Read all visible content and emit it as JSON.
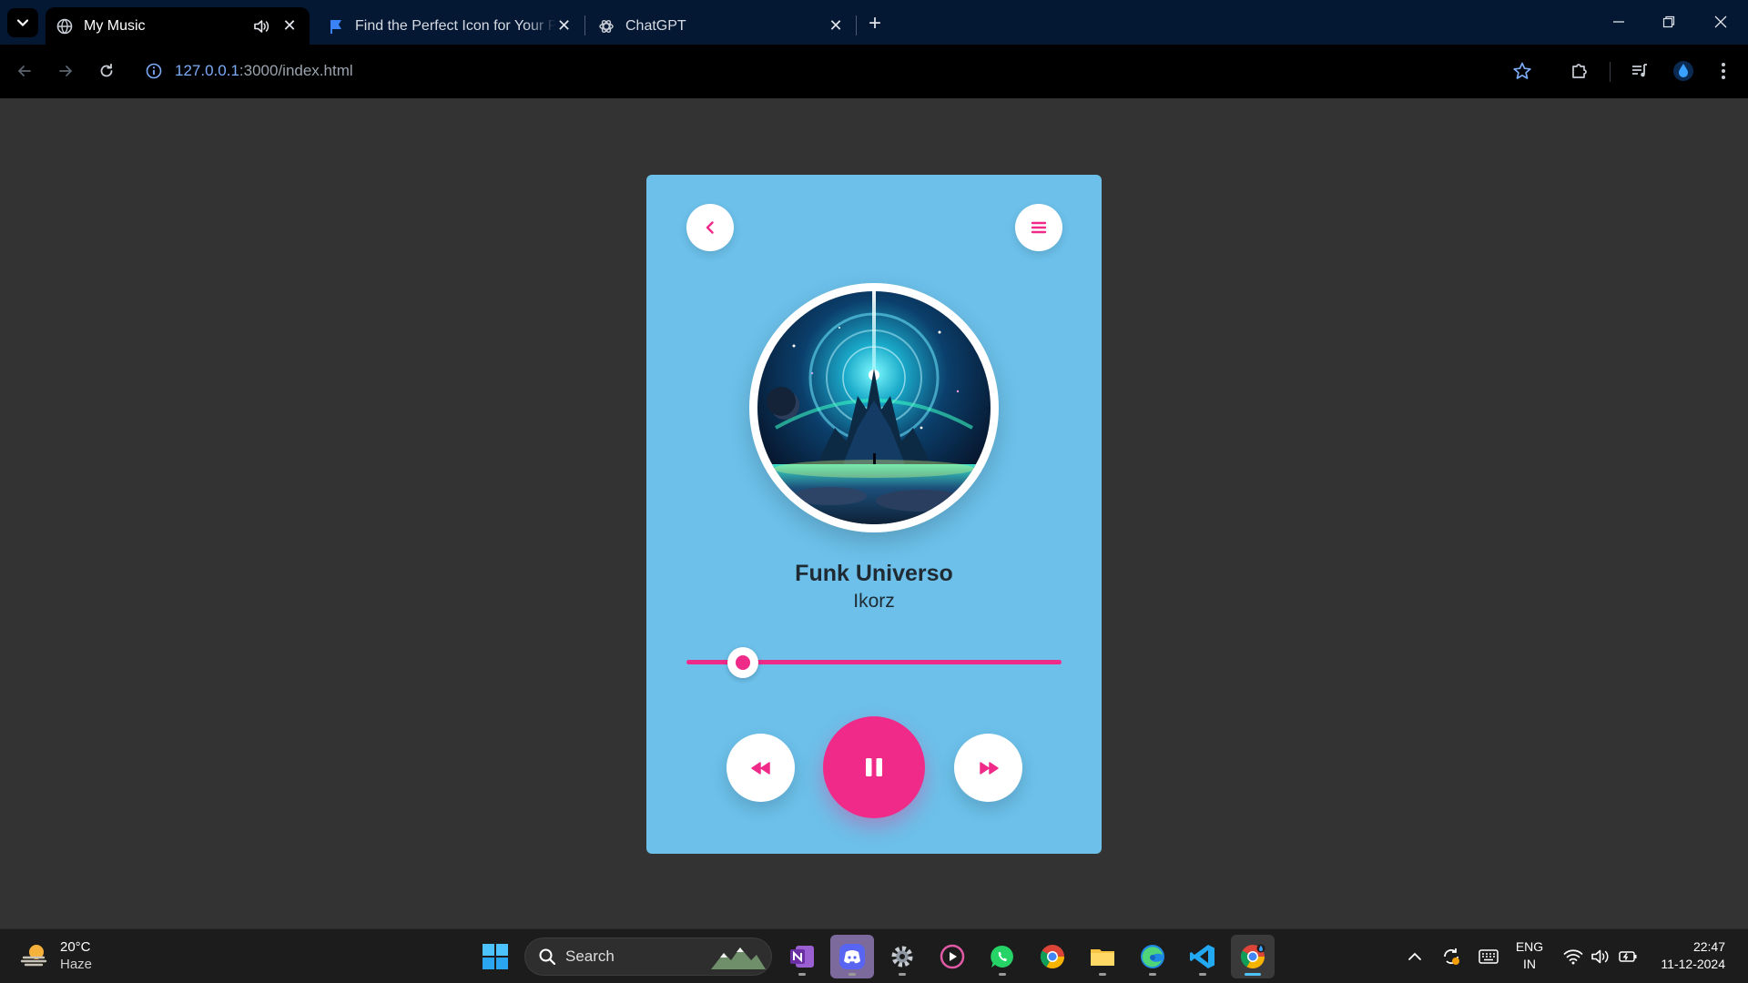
{
  "browser": {
    "tabs": [
      {
        "title": "My Music",
        "active": true,
        "audio": true
      },
      {
        "title": "Find the Perfect Icon for Your Project",
        "active": false
      },
      {
        "title": "ChatGPT",
        "active": false
      }
    ],
    "url_host": "127.0.0.1",
    "url_rest": ":3000/index.html"
  },
  "player": {
    "song_title": "Funk Universo",
    "artist": "Ikorz",
    "progress": 0.15,
    "state": "playing",
    "accent_color": "#f02a88",
    "card_color": "#6cc0ea",
    "icons": {
      "back": "chevron-left-icon",
      "menu": "hamburger-menu-icon",
      "prev": "rewind-icon",
      "play_pause": "pause-icon",
      "next": "fast-forward-icon"
    }
  },
  "taskbar": {
    "weather_temp": "20°C",
    "weather_desc": "Haze",
    "search_label": "Search",
    "lang_primary": "ENG",
    "lang_secondary": "IN",
    "time": "22:47",
    "date": "11-12-2024"
  }
}
